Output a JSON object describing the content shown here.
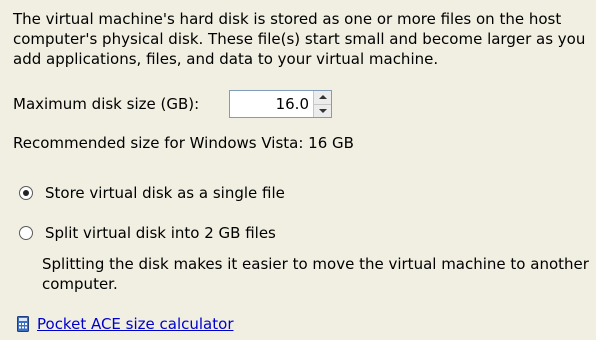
{
  "intro": {
    "line1": "The virtual machine's hard disk is stored as one or more files on the host",
    "line2": "computer's physical disk. These file(s) start small and become larger as you",
    "line3": "add applications, files, and data to your virtual machine."
  },
  "disk_size": {
    "label": "Maximum disk size (GB):",
    "value": "16.0"
  },
  "recommended": "Recommended size for Windows Vista: 16 GB",
  "options": {
    "single": {
      "label": "Store virtual disk as a single file",
      "selected": true
    },
    "split": {
      "label": "Split virtual disk into 2 GB files",
      "selected": false
    }
  },
  "split_note": {
    "line1": "Splitting the disk makes it easier to move the virtual machine to another",
    "line2": "computer."
  },
  "calculator": {
    "link_text": "Pocket ACE size calculator",
    "icon": "calculator-icon"
  },
  "colors": {
    "background": "#f1efe2",
    "link": "#0000cc"
  }
}
